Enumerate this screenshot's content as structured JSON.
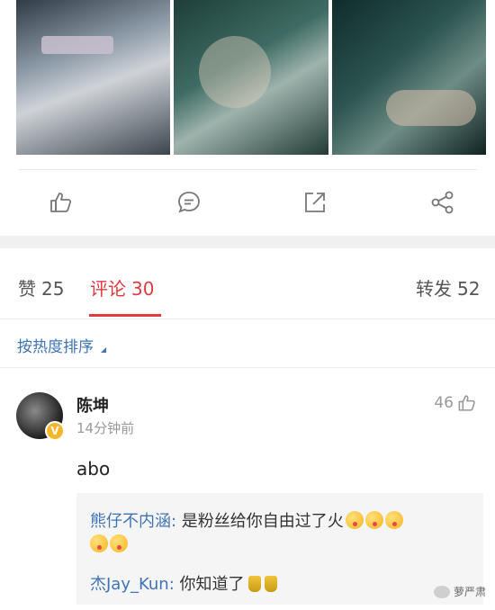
{
  "post": {
    "images": [
      "photo-collage-1",
      "photo-collage-2",
      "photo-collage-3"
    ],
    "actions": [
      "thumbs-up-icon",
      "comment-icon",
      "share-out-icon",
      "share-icon"
    ]
  },
  "tabs": {
    "likes": {
      "label": "赞",
      "count": "25"
    },
    "comments": {
      "label": "评论",
      "count": "30"
    },
    "reposts": {
      "label": "转发",
      "count": "52"
    }
  },
  "sort": {
    "label": "按热度排序"
  },
  "comment": {
    "user": "陈坤",
    "time": "14分钟前",
    "likes": "46",
    "text": "abo",
    "verified_badge": "V"
  },
  "replies": [
    {
      "user": "熊仔不内涵",
      "sep": ":",
      "text": " 是粉丝给你自由过了火",
      "emoji_count": 5
    },
    {
      "user": "杰Jay_Kun",
      "sep": ":",
      "text": " 你知道了",
      "emoji_count": 2
    }
  ],
  "watermark": {
    "text": "萝严肃"
  },
  "colors": {
    "accent": "#e0393e",
    "link": "#3f74b4",
    "badge": "#f6b629"
  }
}
